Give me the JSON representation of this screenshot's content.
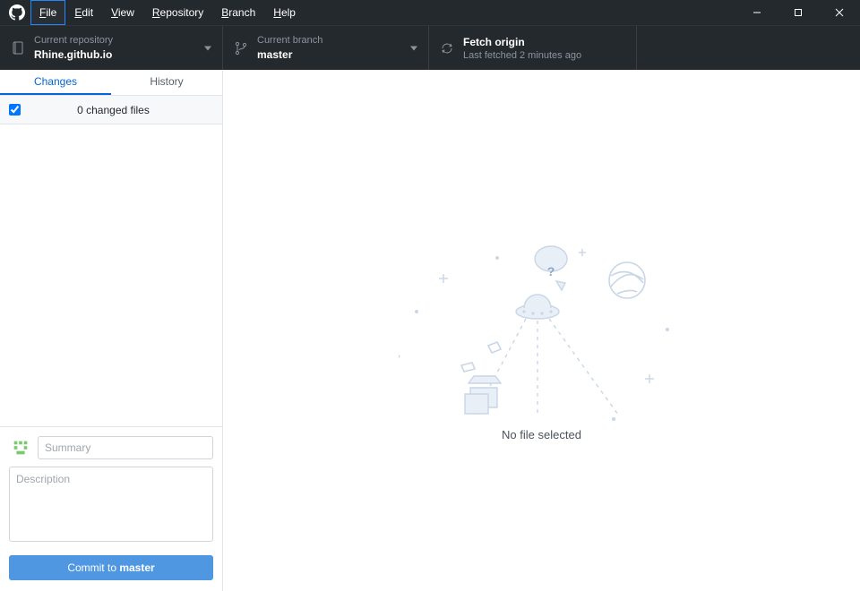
{
  "menubar": {
    "items": [
      {
        "label": "File",
        "underline": "F",
        "selected": true
      },
      {
        "label": "Edit",
        "underline": "E"
      },
      {
        "label": "View",
        "underline": "V"
      },
      {
        "label": "Repository",
        "underline": "R"
      },
      {
        "label": "Branch",
        "underline": "B"
      },
      {
        "label": "Help",
        "underline": "H"
      }
    ]
  },
  "toolbar": {
    "repo": {
      "label": "Current repository",
      "value": "Rhine.github.io"
    },
    "branch": {
      "label": "Current branch",
      "value": "master"
    },
    "fetch": {
      "label": "Fetch origin",
      "sub": "Last fetched 2 minutes ago"
    }
  },
  "sidebar": {
    "tabs": {
      "changes": "Changes",
      "history": "History",
      "active": "changes"
    },
    "changed_files_label": "0 changed files",
    "all_checked": true
  },
  "commit": {
    "summary_placeholder": "Summary",
    "description_placeholder": "Description",
    "button_prefix": "Commit to ",
    "button_branch": "master"
  },
  "main": {
    "empty_text": "No file selected"
  }
}
